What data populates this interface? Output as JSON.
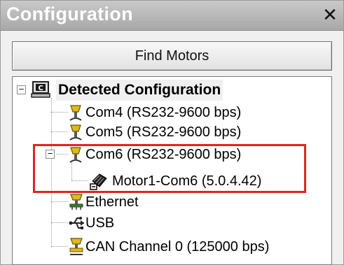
{
  "panel": {
    "title": "Configuration",
    "close_glyph": "✕"
  },
  "toolbar": {
    "find_motors_label": "Find Motors"
  },
  "tree": {
    "root": {
      "label": "Detected Configuration",
      "icon": "computer-icon",
      "expanded": true
    },
    "items": [
      {
        "label": "Com4 (RS232-9600 bps)",
        "icon": "serial-port-icon"
      },
      {
        "label": "Com5 (RS232-9600 bps)",
        "icon": "serial-port-icon"
      },
      {
        "label": "Com6 (RS232-9600 bps)",
        "icon": "serial-port-icon",
        "expanded": true,
        "children": [
          {
            "label": "Motor1-Com6 (5.0.4.42)",
            "icon": "motor-icon"
          }
        ]
      },
      {
        "label": "Ethernet",
        "icon": "network-icon"
      },
      {
        "label": "USB",
        "icon": "usb-icon"
      },
      {
        "label": "CAN Channel 0 (125000 bps)",
        "icon": "can-bus-icon"
      }
    ]
  },
  "colors": {
    "highlight_box": "#e02424",
    "port_icon": "#d9b21a",
    "title_text": "#ffffff"
  }
}
